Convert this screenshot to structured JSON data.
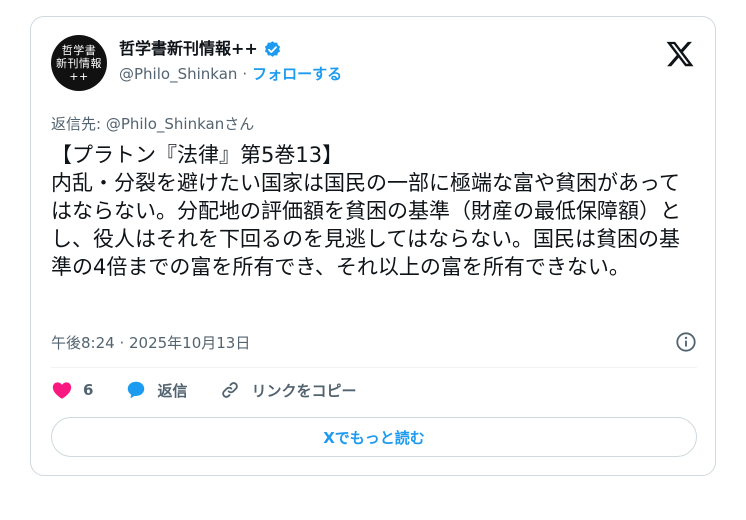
{
  "author": {
    "avatar_lines": [
      "哲学書",
      "新刊情報",
      "++"
    ],
    "display_name": "哲学書新刊情報++",
    "handle": "@Philo_Shinkan",
    "separator": "·",
    "follow_label": "フォローする"
  },
  "reply_to": "返信先: @Philo_Shinkanさん",
  "body": "【プラトン『法律』第5巻13】\n内乱・分裂を避けたい国家は国民の一部に極端な富や貧困があってはならない。分配地の評価額を貧困の基準（財産の最低保障額）とし、役人はそれを下回るのを見逃してはならない。国民は貧困の基準の4倍までの富を所有でき、それ以上の富を所有できない。",
  "timestamp": "午後8:24 · 2025年10月13日",
  "actions": {
    "like_count": "6",
    "reply_label": "返信",
    "copy_link_label": "リンクをコピー"
  },
  "read_more_label": "Xでもっと読む",
  "colors": {
    "accent": "#1d9bf0",
    "like": "#f91880",
    "border": "#cfd9de",
    "muted": "#536471"
  }
}
